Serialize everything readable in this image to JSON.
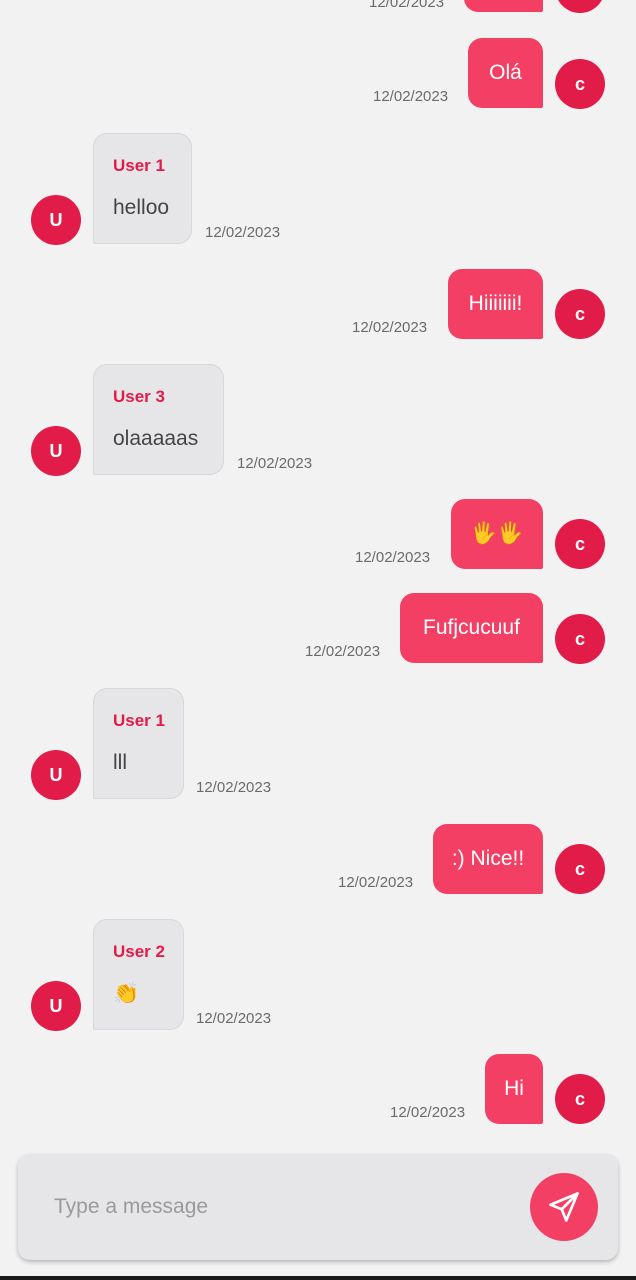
{
  "theme": {
    "accent": "#f43f64",
    "avatar_color": "#e21c48",
    "incoming_bubble": "#e6e6e9",
    "background": "#f2f2f2"
  },
  "messages": [
    {
      "from": "me",
      "avatar": "c",
      "text": "",
      "time": "12/02/2023"
    },
    {
      "from": "me",
      "avatar": "c",
      "text": "Olá",
      "time": "12/02/2023"
    },
    {
      "from": "other",
      "avatar": "U",
      "sender": "User 1",
      "text": "helloo",
      "time": "12/02/2023"
    },
    {
      "from": "me",
      "avatar": "c",
      "text": "Hiiiiiii!",
      "time": "12/02/2023"
    },
    {
      "from": "other",
      "avatar": "U",
      "sender": "User 3",
      "text": "olaaaaas",
      "time": "12/02/2023"
    },
    {
      "from": "me",
      "avatar": "c",
      "text": "🖐🖐",
      "time": "12/02/2023"
    },
    {
      "from": "me",
      "avatar": "c",
      "text": "Fufjcucuuf",
      "time": "12/02/2023"
    },
    {
      "from": "other",
      "avatar": "U",
      "sender": "User 1",
      "text": "lll",
      "time": "12/02/2023"
    },
    {
      "from": "me",
      "avatar": "c",
      "text": ":) Nice!!",
      "time": "12/02/2023"
    },
    {
      "from": "other",
      "avatar": "U",
      "sender": "User 2",
      "text": "👏",
      "time": "12/02/2023"
    },
    {
      "from": "me",
      "avatar": "c",
      "text": "Hi",
      "time": "12/02/2023"
    }
  ],
  "composer": {
    "placeholder": "Type a message",
    "value": "",
    "send_icon": "send-icon"
  }
}
